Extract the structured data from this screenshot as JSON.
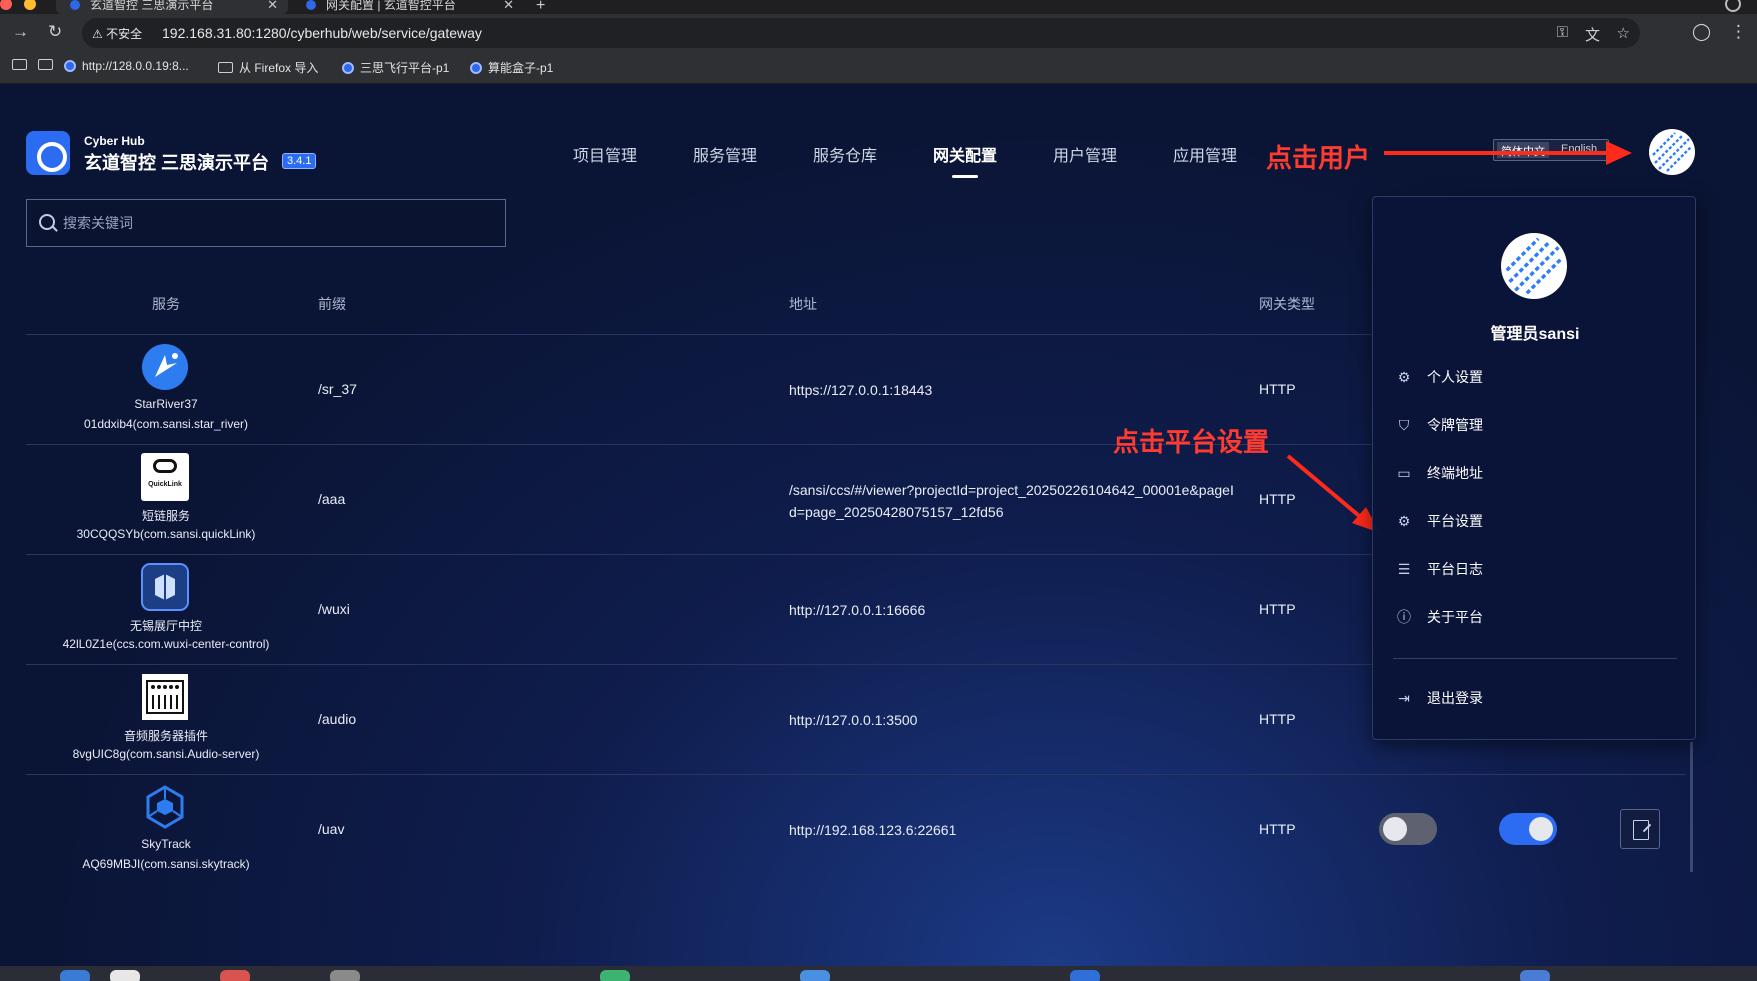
{
  "browser": {
    "tabs": [
      {
        "title": "玄道智控 三思演示平台"
      },
      {
        "title": "网关配置 | 玄道智控平台"
      }
    ],
    "insecure_label": "不安全",
    "url": "192.168.31.80:1280/cyberhub/web/service/gateway",
    "bookmarks": [
      {
        "label": "http://128.0.0.19:8..."
      },
      {
        "label": "从 Firefox 导入"
      },
      {
        "label": "三思飞行平台-p1"
      },
      {
        "label": "算能盒子-p1"
      }
    ]
  },
  "header": {
    "brand_sub": "Cyber Hub",
    "brand_title": "玄道智控 三思演示平台",
    "version": "3.4.1",
    "nav": [
      {
        "label": "项目管理",
        "active": false
      },
      {
        "label": "服务管理",
        "active": false
      },
      {
        "label": "服务仓库",
        "active": false
      },
      {
        "label": "网关配置",
        "active": true
      },
      {
        "label": "用户管理",
        "active": false
      },
      {
        "label": "应用管理",
        "active": false
      }
    ],
    "lang_zh": "简体中文",
    "lang_en": "English"
  },
  "annotations": {
    "click_user": "点击用户",
    "click_platform_settings": "点击平台设置",
    "color": "#ff3b30"
  },
  "search": {
    "placeholder": "搜索关键词"
  },
  "table": {
    "headers": {
      "service": "服务",
      "prefix": "前缀",
      "address": "地址",
      "gateway_type": "网关类型"
    },
    "rows": [
      {
        "name": "StarRiver37",
        "id": "01ddxib4(com.sansi.star_river)",
        "prefix": "/sr_37",
        "address": "https://127.0.0.1:18443",
        "type": "HTTP",
        "icon": "star-river-icon"
      },
      {
        "name": "短链服务",
        "id": "30CQQSYb(com.sansi.quickLink)",
        "prefix": "/aaa",
        "address": "/sansi/ccs/#/viewer?projectId=project_20250226104642_00001e&pageId=page_20250428075157_12fd56",
        "type": "HTTP",
        "icon": "quicklink-icon",
        "icon_text": "QuickLink"
      },
      {
        "name": "无锡展厅中控",
        "id": "42lL0Z1e(ccs.com.wuxi-center-control)",
        "prefix": "/wuxi",
        "address": "http://127.0.0.1:16666",
        "type": "HTTP",
        "icon": "cube-stack-icon"
      },
      {
        "name": "音频服务器插件",
        "id": "8vgUIC8g(com.sansi.Audio-server)",
        "prefix": "/audio",
        "address": "http://127.0.0.1:3500",
        "type": "HTTP",
        "icon": "audio-mixer-icon"
      },
      {
        "name": "SkyTrack",
        "id": "AQ69MBJI(com.sansi.skytrack)",
        "prefix": "/uav",
        "address": "http://192.168.123.6:22661",
        "type": "HTTP",
        "icon": "hexagon-network-icon",
        "toggle1_on": false,
        "toggle2_on": true
      }
    ]
  },
  "user_menu": {
    "username": "管理员sansi",
    "items": [
      {
        "label": "个人设置",
        "icon": "settings-icon"
      },
      {
        "label": "令牌管理",
        "icon": "shield-icon"
      },
      {
        "label": "终端地址",
        "icon": "monitor-icon"
      },
      {
        "label": "平台设置",
        "icon": "gear-icon"
      },
      {
        "label": "平台日志",
        "icon": "document-icon"
      },
      {
        "label": "关于平台",
        "icon": "info-icon"
      }
    ],
    "logout": "退出登录"
  },
  "colors": {
    "accent": "#2c6cf2",
    "toggle_on": "#2c6cf2",
    "toggle_off": "#5d6170"
  }
}
